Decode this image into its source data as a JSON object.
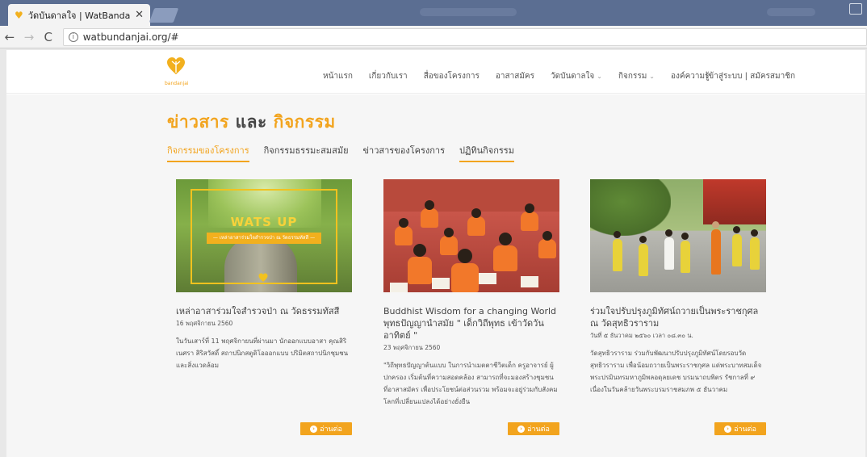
{
  "browser": {
    "tab_title": "วัดบันดาลใจ | WatBandanj",
    "close_glyph": "✕",
    "back_glyph": "←",
    "forward_glyph": "→",
    "reload_glyph": "C",
    "url": "watbundanjai.org/#"
  },
  "site": {
    "logo_text": "bandanjai",
    "menu": [
      {
        "label": "หน้าแรก"
      },
      {
        "label": "เกี่ยวกับเรา"
      },
      {
        "label": "สื่อของโครงการ"
      },
      {
        "label": "อาสาสมัคร"
      },
      {
        "label": "วัดบันดาลใจ",
        "caret": "⌄"
      },
      {
        "label": "กิจกรรม",
        "caret": "⌄"
      },
      {
        "label": "องค์ความรู้"
      }
    ],
    "login": "เข้าสู่ระบบ | สมัครสมาชิก"
  },
  "main": {
    "heading_part1": "ข่าวสาร",
    "heading_and": "และ",
    "heading_part2": "กิจกรรม",
    "tabs": [
      {
        "label": "กิจกรรมของโครงการ",
        "active": true
      },
      {
        "label": "กิจกรรมธรรมะสมสมัย"
      },
      {
        "label": "ข่าวสารของโครงการ"
      },
      {
        "label": "ปฏิทินกิจกรรม",
        "underlined": true
      }
    ],
    "cards": [
      {
        "thumb_text": "WATS UP",
        "thumb_ribbon": "— เหล่าอาสาร่วมใจสำรวจป่า ณ วัดธรรมทัสสี —",
        "title": "เหล่าอาสาร่วมใจสำรวจป่า ณ วัดธรรมทัสสี",
        "date": "16 พฤศจิกายน 2560",
        "excerpt": "ในวันเสาร์ที่ 11 พฤศจิกายนที่ผ่านมา นักออกแบบอาสา คุณสิริเนศรา สิริสวัสดิ์ สถาปนิกสตูดิโอออกแบบ ปริมิตสถาปนิกชุมชนและสิ่งแวดล้อม",
        "readmore": "อ่านต่อ"
      },
      {
        "title": "Buddhist Wisdom for a changing World พุทธปัญญานำสมัย \" เด็กวิถีพุทธ เข้าวัดวันอาทิตย์ \"",
        "date": "23 พฤศจิกายน 2560",
        "excerpt": "\"วิถีพุทธปัญญาต้นแบบ ในการนำเมตตาชีวิตเด็ก ครูอาจารย์ ผู้ปกครอง เริ่มต้นที่ความสอดคล้อง สามารถที่จะมองสร้างชุมชน ที่อาสาสมัคร เพื่อประโยชน์ต่อส่วนรวม พร้อมจะอยู่ร่วมกับสังคมโลกที่เปลี่ยนแปลงได้อย่างยั่งยืน",
        "readmore": "อ่านต่อ"
      },
      {
        "title": "ร่วมใจปรับปรุงภูมิทัศน์ถวายเป็นพระราชกุศล ณ วัดสุทธิวราราม",
        "date": "วันที่ ๕ ธันวาคม ๒๕๖๐ เวลา ๐๘.๓๐ น.",
        "excerpt": "วัดสุทธิวราราม ร่วมกับพัฒนาปรับปรุงภูมิทัศน์โดยรอบวัด สุทธิวราราม เพื่อน้อมถวายเป็นพระราชกุศล แด่พระบาทสมเด็จพระปรมินทรมหาภูมิพลอดุลยเดช บรมนาถบพิตร รัชกาลที่ ๙ เนื่องในวันคล้ายวันพระบรมราชสมภพ ๕ ธันวาคม",
        "readmore": "อ่านต่อ"
      }
    ]
  },
  "colors": {
    "accent": "#f2a41e",
    "tabbar": "#5b6e92"
  }
}
